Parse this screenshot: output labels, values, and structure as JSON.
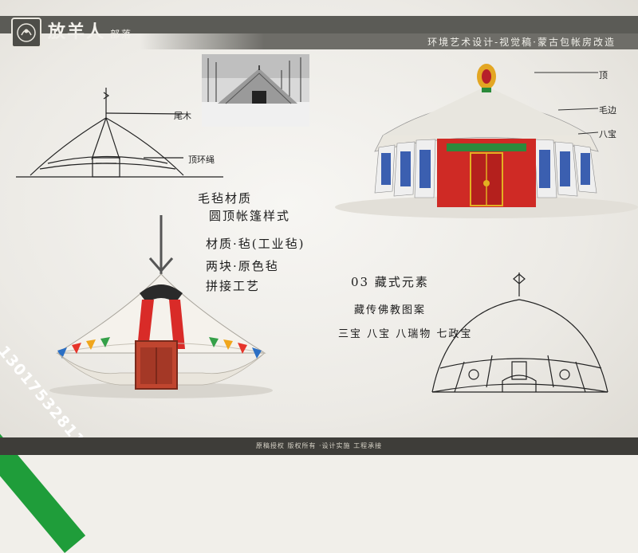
{
  "header": {
    "brand": "放羊人",
    "brand_sub": "部落",
    "subtitle": "环境艺术设计-视觉稿·蒙古包帐房改造"
  },
  "annotations": {
    "sketch1_top": "尾木",
    "sketch1_mid": "顶环绳",
    "tent_top": "顶",
    "tent_edge": "毛边",
    "tent_side": "八宝"
  },
  "notes": {
    "block1": [
      "毛毡材质",
      "圆顶帐篷样式"
    ],
    "block2": [
      "材质·毡(工业毡)"
    ],
    "block3": [
      "两块·原色毡",
      "拼接工艺"
    ],
    "block4_title": "03 藏式元素",
    "block4_lines": [
      "藏传佛教图案",
      "三宝  八宝  八瑞物  七政宝"
    ]
  },
  "watermark": {
    "phone": "13017532811"
  },
  "footer": {
    "text": "原稿授权 版权所有 ·设计实施 工程承接"
  },
  "colors": {
    "header_bar": "#5b5b56",
    "phone_band": "#1f9d3a",
    "footer": "#3e3d39",
    "tent_red": "#d92b28"
  }
}
